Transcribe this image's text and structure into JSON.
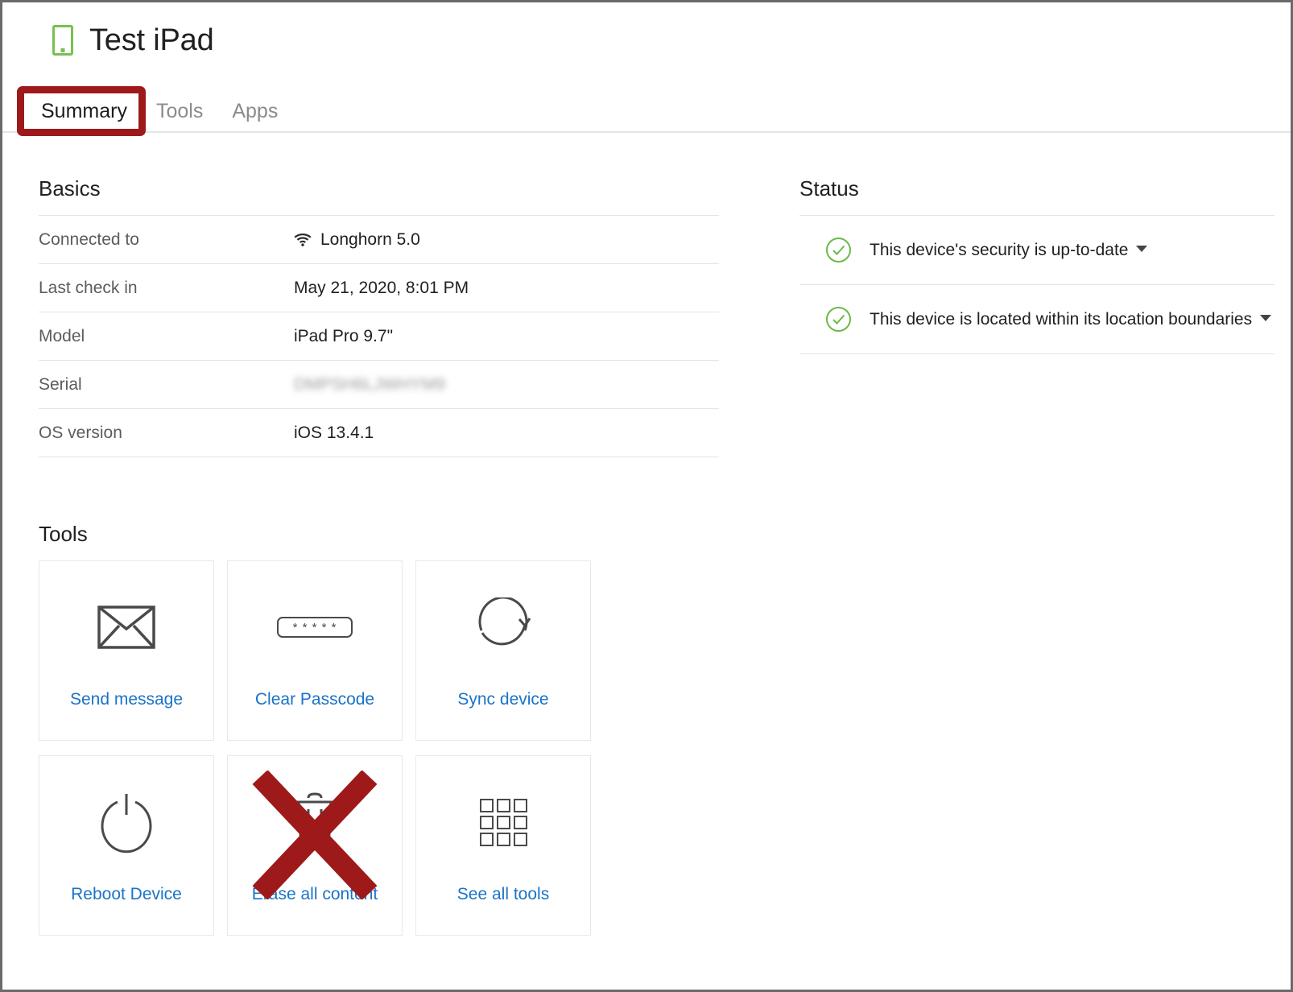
{
  "header": {
    "device_icon": "tablet-icon",
    "title": "Test iPad"
  },
  "tabs": [
    {
      "label": "Summary",
      "active": true
    },
    {
      "label": "Tools",
      "active": false
    },
    {
      "label": "Apps",
      "active": false
    }
  ],
  "basics": {
    "title": "Basics",
    "rows": [
      {
        "label": "Connected to",
        "value": "Longhorn 5.0",
        "icon": "wifi-icon",
        "redacted": true
      },
      {
        "label": "Last check in",
        "value": "May 21, 2020, 8:01 PM",
        "redacted": false
      },
      {
        "label": "Model",
        "value": "iPad Pro 9.7\"",
        "redacted": false
      },
      {
        "label": "Serial",
        "value": "DMPSH6LJWHYM9",
        "redacted": true
      },
      {
        "label": "OS version",
        "value": "iOS 13.4.1",
        "redacted": false
      }
    ]
  },
  "status": {
    "title": "Status",
    "rows": [
      {
        "label": "This device's security is up-to-date",
        "icon": "check-circle-icon"
      },
      {
        "label": "This device is located within its location boundaries",
        "icon": "check-circle-icon"
      }
    ]
  },
  "tools": {
    "title": "Tools",
    "cards": [
      {
        "label": "Send message",
        "icon": "envelope-icon"
      },
      {
        "label": "Clear Passcode",
        "icon": "passcode-icon",
        "passcode_mask": "* * * * *"
      },
      {
        "label": "Sync device",
        "icon": "sync-icon"
      },
      {
        "label": "Reboot Device",
        "icon": "power-icon"
      },
      {
        "label": "Erase all content",
        "icon": "trash-icon",
        "annotated": true
      },
      {
        "label": "See all tools",
        "icon": "grid-icon"
      }
    ]
  },
  "colors": {
    "accent_green": "#7ac143",
    "link_blue": "#1a73c8",
    "annotation_red": "#9e1a1a",
    "status_green": "#6aba4a",
    "border_gray": "#e4e4e4"
  }
}
